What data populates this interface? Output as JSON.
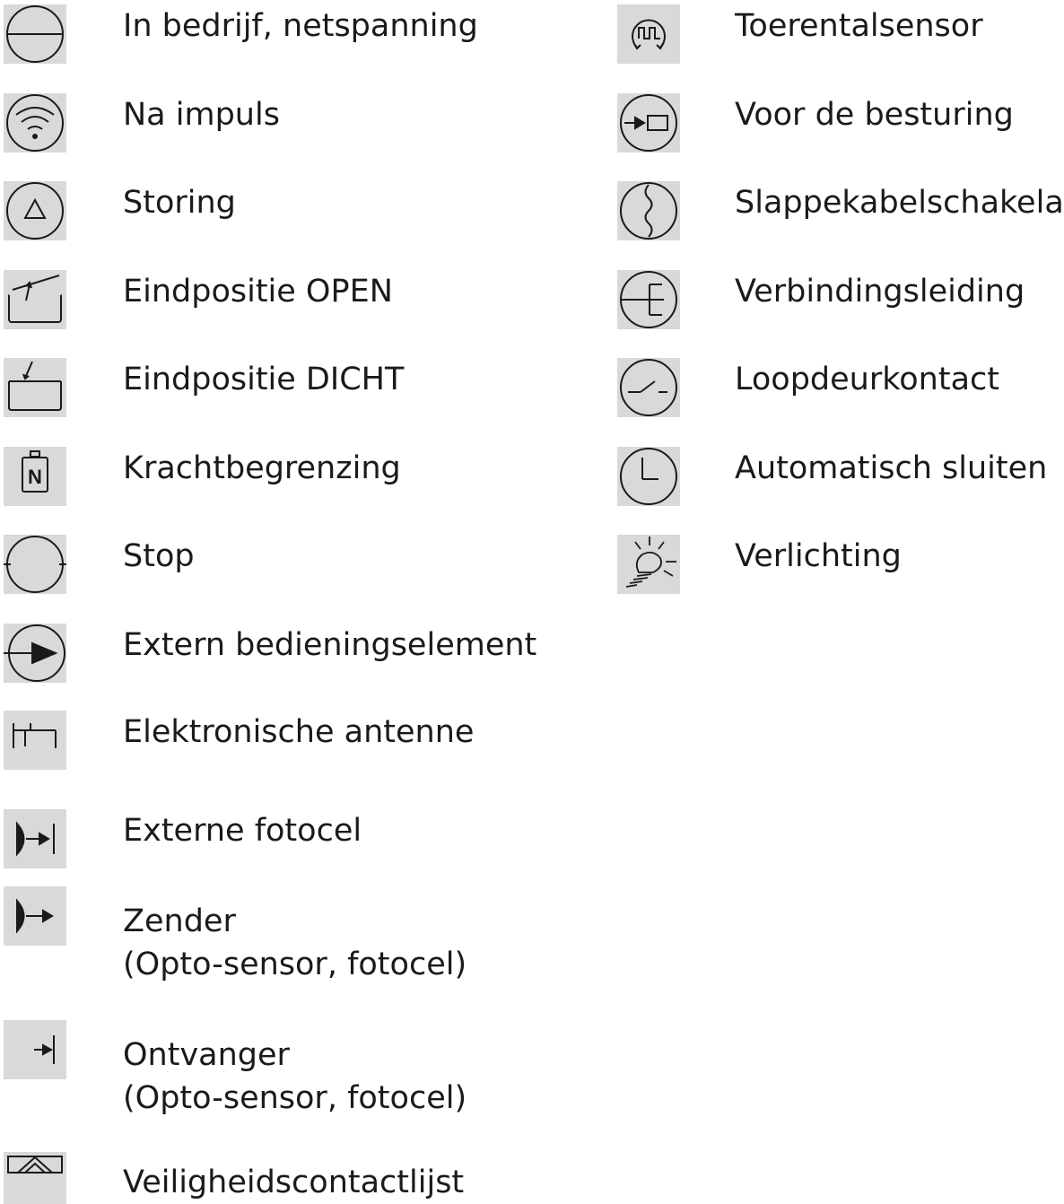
{
  "left_column": [
    {
      "label": "In bedrijf, netspanning",
      "icon": "power-on-icon"
    },
    {
      "label": "Na impuls",
      "icon": "impulse-icon"
    },
    {
      "label": "Storing",
      "icon": "fault-triangle-icon"
    },
    {
      "label": "Eindpositie OPEN",
      "icon": "end-position-open-icon"
    },
    {
      "label": "Eindpositie DICHT",
      "icon": "end-position-closed-icon"
    },
    {
      "label": "Krachtbegrenzing",
      "icon": "force-limit-icon"
    },
    {
      "label": "Stop",
      "icon": "stop-icon"
    },
    {
      "label": "Extern bedieningselement",
      "icon": "external-control-icon"
    },
    {
      "label": "Elektronische antenne",
      "icon": "antenna-icon"
    },
    {
      "label": "Externe fotocel",
      "icon": "external-photocell-icon"
    },
    {
      "label": "Zender",
      "label2": "(Opto-sensor, fotocel)",
      "icon": "transmitter-icon"
    },
    {
      "label": "Ontvanger",
      "label2": "(Opto-sensor, fotocel)",
      "icon": "receiver-icon"
    },
    {
      "label": "Veiligheidscontactlijst",
      "icon": "safety-edge-icon"
    }
  ],
  "right_column": [
    {
      "label": "Toerentalsensor",
      "icon": "speed-sensor-icon"
    },
    {
      "label": "Voor de besturing",
      "icon": "to-control-icon"
    },
    {
      "label": "Slappekabelschakelaar",
      "icon": "slack-cable-icon"
    },
    {
      "label": "Verbindingsleiding",
      "icon": "connection-line-icon"
    },
    {
      "label": "Loopdeurkontact",
      "icon": "wicket-door-contact-icon"
    },
    {
      "label": "Automatisch sluiten",
      "icon": "automatic-close-icon"
    },
    {
      "label": "Verlichting",
      "icon": "lighting-icon"
    }
  ],
  "colors": {
    "icon_background": "#d9d9d9",
    "stroke": "#1a1a1a",
    "text": "#1a1a1a"
  }
}
